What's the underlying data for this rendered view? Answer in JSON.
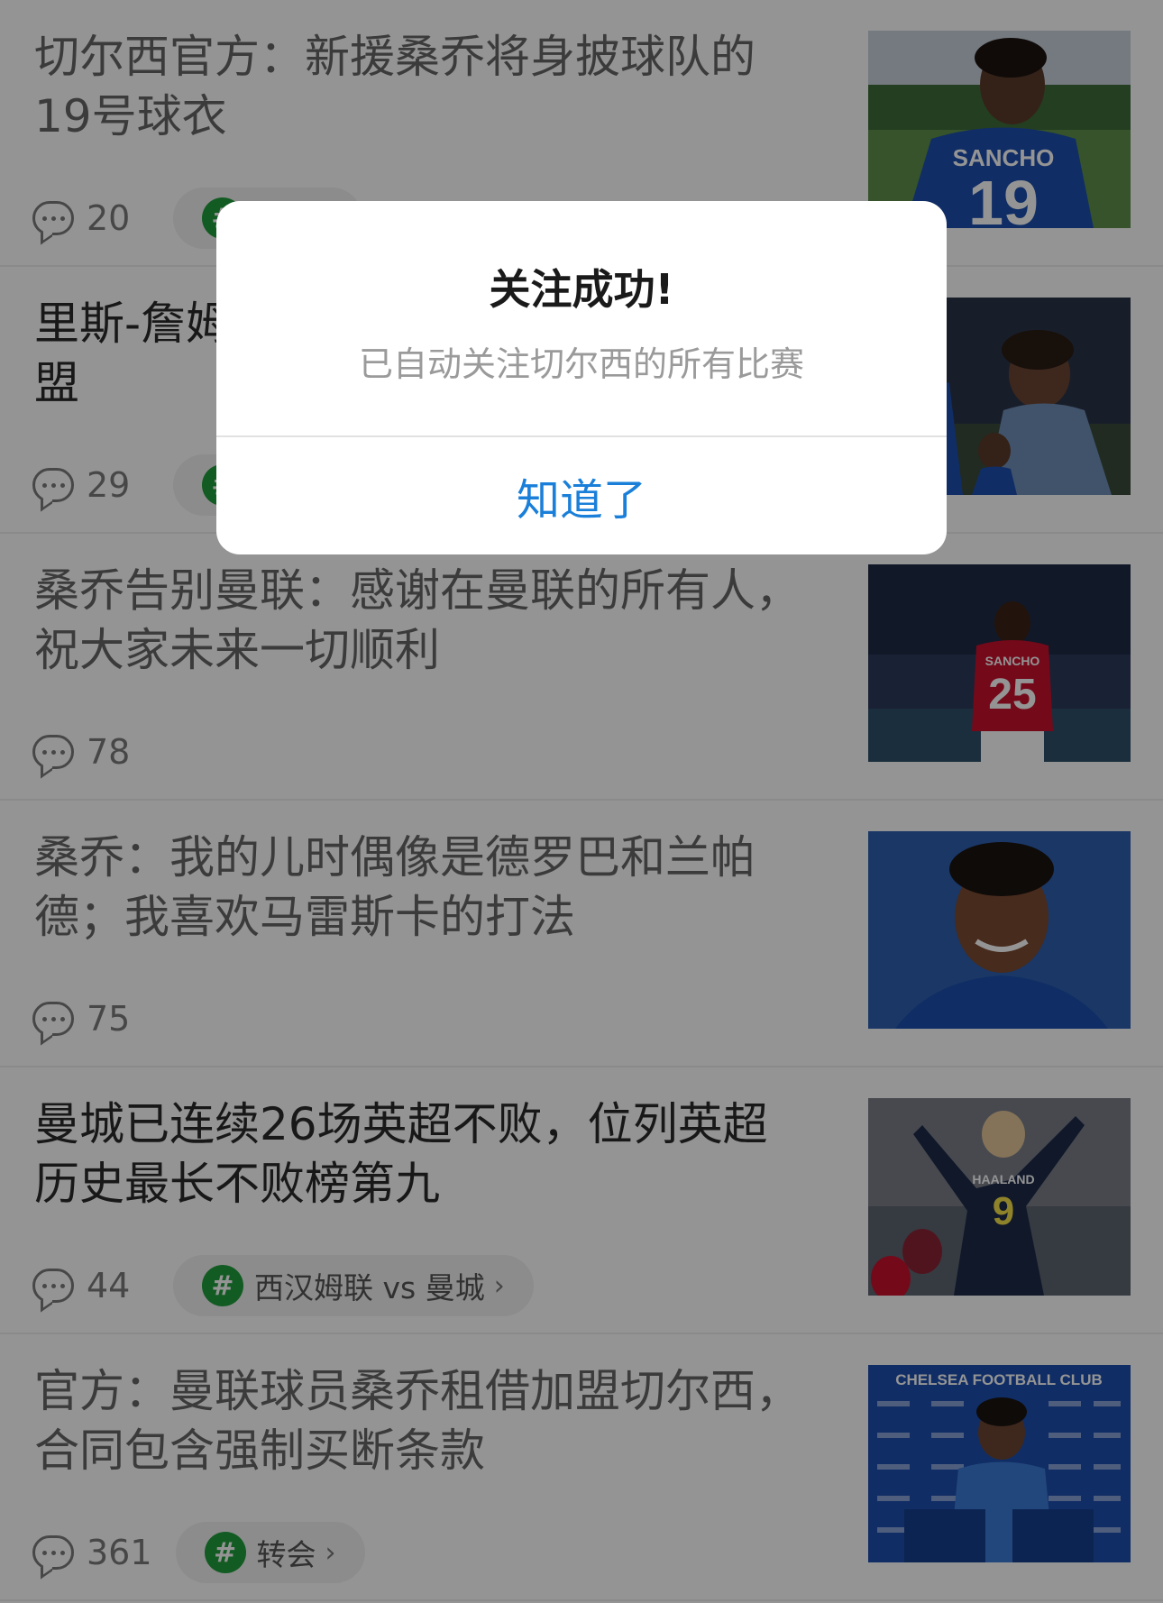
{
  "feed": {
    "items": [
      {
        "title": "切尔西官方：新援桑乔将身披球队的19号球衣",
        "comments": "20",
        "topic": "转会"
      },
      {
        "title": "里斯-詹姆斯与桑乔交手照欢迎后者加盟",
        "comments": "29",
        "topic": ""
      },
      {
        "title": "桑乔告别曼联：感谢在曼联的所有人，祝大家未来一切顺利",
        "comments": "78"
      },
      {
        "title": "桑乔：我的儿时偶像是德罗巴和兰帕德；我喜欢马雷斯卡的打法",
        "comments": "75"
      },
      {
        "title": "曼城已连续26场英超不败，位列英超历史最长不败榜第九",
        "comments": "44",
        "topic": "西汉姆联 vs 曼城"
      },
      {
        "title": "官方：曼联球员桑乔租借加盟切尔西，合同包含强制买断条款",
        "comments": "361",
        "topic": "转会"
      }
    ],
    "thumb_texts": {
      "sancho_back": "SANCHO",
      "number_19": "19",
      "sancho_red": "SANCHO",
      "number_25": "25",
      "haaland": "HAALAND",
      "number_9": "9",
      "club_banner": "CHELSEA FOOTBALL CLUB"
    }
  },
  "dialog": {
    "title": "关注成功!",
    "message": "已自动关注切尔西的所有比赛",
    "button": "知道了"
  },
  "colors": {
    "accent": "#1a7fd9",
    "topic_green": "#1f9e3c",
    "chelsea_blue": "#1d4fae",
    "united_red": "#c8102e"
  }
}
